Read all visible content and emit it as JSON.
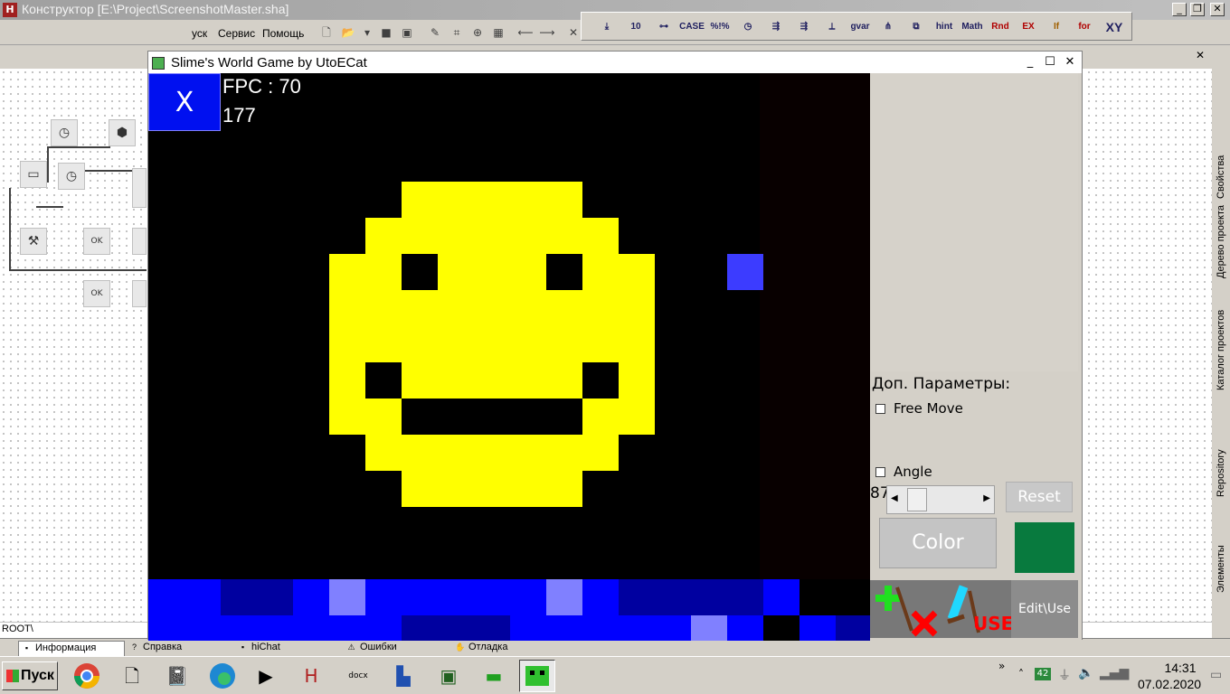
{
  "app": {
    "title": "Конструктор [E:\\Project\\ScreenshotMaster.sha]",
    "menu": [
      "уск",
      "Сервис",
      "Помощь"
    ],
    "root_path": "ROOT\\"
  },
  "component_toolbar": [
    "⤓",
    "10",
    "⊶",
    "CASE",
    "%!%",
    "◷",
    "⇶",
    "⇶",
    "⟂",
    "gvar",
    "⋔",
    "⧉",
    "hint",
    "Math",
    "Rnd",
    "EX",
    "If",
    "for",
    "XY"
  ],
  "right_dock": [
    "Свойства",
    "Дерево проекта",
    "Каталог проектов",
    "Repository",
    "Элементы"
  ],
  "bottom_tabs": [
    "Информация",
    "Справка",
    "hiChat",
    "Ошибки",
    "Отладка"
  ],
  "taskbar": {
    "start_label": "Пуск",
    "time": "14:31",
    "date": "07.02.2020",
    "tray_badge": "42"
  },
  "game": {
    "window_title": "Slime's World Game by UtoECat",
    "close_label": "X",
    "fpc_label": "FPC : 70",
    "counter": "177",
    "params_title": "Доп. Параметры:",
    "free_move_label": "Free Move",
    "angle_label": "Angle",
    "angle_value": "87",
    "reset_label": "Reset",
    "color_label": "Color",
    "color_value": "#087a3e",
    "use_label": "USE",
    "edit_use_label": "Edit\\Use"
  }
}
